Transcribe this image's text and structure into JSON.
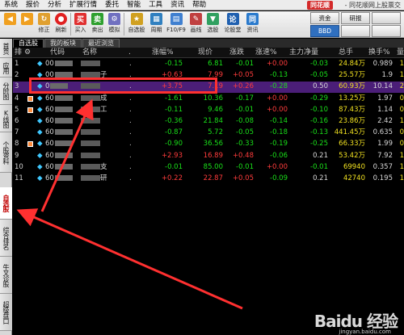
{
  "menubar": {
    "items": [
      "系统",
      "报价",
      "分析",
      "扩展行情",
      "委托",
      "智能",
      "工具",
      "资讯",
      "帮助"
    ],
    "brand": "同花顺",
    "title": "- 同花顺网上股票交"
  },
  "toolbar": {
    "buttons": [
      {
        "label": "",
        "icon": "arrow-left",
        "color": "#f0a020"
      },
      {
        "label": "",
        "icon": "arrow-right",
        "color": "#f0a020"
      },
      {
        "label": "修正",
        "icon": "refresh",
        "color": "#e0a030"
      },
      {
        "label": "刷新",
        "icon": "circle",
        "color": "#e02020"
      },
      {
        "label": "买入",
        "icon": "buy",
        "color": "#e03030"
      },
      {
        "label": "卖出",
        "icon": "sell",
        "color": "#2ea02e"
      },
      {
        "label": "模拟",
        "icon": "gear",
        "color": "#7070c0"
      },
      {
        "label": "自选股",
        "icon": "star",
        "color": "#d0a020"
      },
      {
        "label": "周期",
        "icon": "calendar",
        "color": "#3080c0"
      },
      {
        "label": "F10/F9",
        "icon": "doc",
        "color": "#4080d0"
      },
      {
        "label": "画线",
        "icon": "pen",
        "color": "#c04040"
      },
      {
        "label": "选股",
        "icon": "filter",
        "color": "#30a060"
      },
      {
        "label": "论股堂",
        "icon": "chat",
        "color": "#2060b0"
      },
      {
        "label": "资讯",
        "icon": "news",
        "color": "#2a7acc"
      }
    ],
    "right": [
      "资金",
      "研报",
      "BBD",
      "",
      "",
      "",
      ""
    ]
  },
  "left_tabs": [
    "自选股",
    "综合排名",
    "牛叉诊股",
    "超级盘口"
  ],
  "left_tabs_top": [
    "首页",
    "应用",
    "分时图",
    "K线图",
    "个股资料"
  ],
  "subtabs": [
    "自选股",
    "我的板块",
    "最近浏览"
  ],
  "table": {
    "headers": [
      "排",
      "代码",
      "名称",
      ".",
      "涨幅%",
      "现价",
      "涨跌",
      "涨速%",
      "主力净量",
      "总手",
      "换手%",
      "量"
    ],
    "rows": [
      {
        "idx": "1",
        "code": "00",
        "name": "",
        "name_tail": "",
        "chg": "-0.15",
        "price": "6.81",
        "delta": "-0.01",
        "speed": "+0.00",
        "main": "-0.03",
        "vol": "24.84万",
        "turn": "0.989",
        "last": "1"
      },
      {
        "idx": "2",
        "code": "00",
        "name": "",
        "name_tail": "子",
        "chg": "+0.63",
        "price": "7.99",
        "delta": "+0.05",
        "speed": "-0.13",
        "main": "-0.05",
        "vol": "25.57万",
        "turn": "1.9",
        "last": "1"
      },
      {
        "idx": "3",
        "code": "0",
        "name": "",
        "name_tail": "",
        "chg": "+3.75",
        "price": "7.19",
        "delta": "+0.26",
        "speed": "-0.28",
        "main": "0.50",
        "vol": "60.93万",
        "turn": "10.14",
        "last": "2"
      },
      {
        "idx": "4",
        "code": "60",
        "name": "",
        "name_tail": "成",
        "chg": "-1.61",
        "price": "10.36",
        "delta": "-0.17",
        "speed": "+0.00",
        "main": "-0.29",
        "vol": "13.25万",
        "turn": "1.97",
        "last": "0"
      },
      {
        "idx": "5",
        "code": "60",
        "name": "",
        "name_tail": "工",
        "chg": "-0.11",
        "price": "9.46",
        "delta": "-0.01",
        "speed": "+0.00",
        "main": "-0.10",
        "vol": "87.43万",
        "turn": "1.14",
        "last": "0"
      },
      {
        "idx": "6",
        "code": "60",
        "name": "",
        "name_tail": "",
        "chg": "-0.36",
        "price": "21.84",
        "delta": "-0.08",
        "speed": "-0.14",
        "main": "-0.16",
        "vol": "23.86万",
        "turn": "2.42",
        "last": "1"
      },
      {
        "idx": "7",
        "code": "60",
        "name": "",
        "name_tail": "",
        "chg": "-0.87",
        "price": "5.72",
        "delta": "-0.05",
        "speed": "-0.18",
        "main": "-0.13",
        "vol": "441.45万",
        "turn": "0.635",
        "last": "0"
      },
      {
        "idx": "8",
        "code": "60",
        "name": "",
        "name_tail": "",
        "chg": "-0.90",
        "price": "36.56",
        "delta": "-0.33",
        "speed": "-0.19",
        "main": "-0.25",
        "vol": "66.33万",
        "turn": "1.99",
        "last": "0"
      },
      {
        "idx": "9",
        "code": "60",
        "name": "",
        "name_tail": "",
        "chg": "+2.93",
        "price": "16.89",
        "delta": "+0.48",
        "speed": "-0.06",
        "main": "0.21",
        "vol": "53.42万",
        "turn": "7.92",
        "last": "1"
      },
      {
        "idx": "10",
        "code": "60",
        "name": "",
        "name_tail": "支",
        "chg": "-0.01",
        "price": "85.00",
        "delta": "-0.01",
        "speed": "+0.00",
        "main": "-0.01",
        "vol": "69940",
        "turn": "0.357",
        "last": "1"
      },
      {
        "idx": "11",
        "code": "60",
        "name": "",
        "name_tail": "研",
        "chg": "+0.22",
        "price": "22.87",
        "delta": "+0.05",
        "speed": "-0.09",
        "main": "0.21",
        "vol": "42740",
        "turn": "0.195",
        "last": "1"
      }
    ]
  },
  "watermark": {
    "main": "Baidu 经验",
    "sub": "jingyan.baidu.com"
  },
  "colors": {
    "up": "#ff3c3c",
    "down": "#19e019",
    "highlight": "#ff3030",
    "selected_row": "#4b1e78"
  }
}
